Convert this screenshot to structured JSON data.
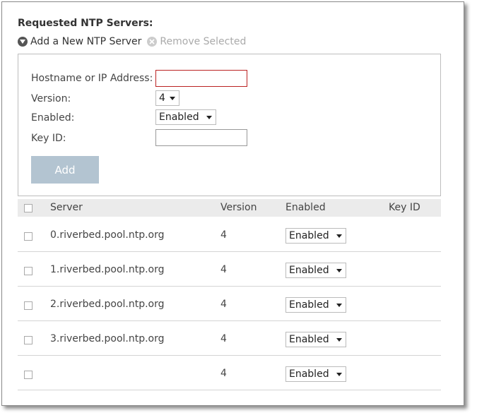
{
  "section_title": "Requested NTP Servers:",
  "actions": {
    "add_label": "Add a New NTP Server",
    "remove_label": "Remove Selected"
  },
  "form": {
    "hostname_label": "Hostname or IP Address:",
    "hostname_value": "",
    "version_label": "Version:",
    "version_value": "4",
    "enabled_label": "Enabled:",
    "enabled_value": "Enabled",
    "keyid_label": "Key ID:",
    "keyid_value": "",
    "add_button": "Add"
  },
  "table": {
    "columns": [
      "Server",
      "Version",
      "Enabled",
      "Key ID"
    ],
    "rows": [
      {
        "server": "0.riverbed.pool.ntp.org",
        "version": "4",
        "enabled": "Enabled",
        "key_id": ""
      },
      {
        "server": "1.riverbed.pool.ntp.org",
        "version": "4",
        "enabled": "Enabled",
        "key_id": ""
      },
      {
        "server": "2.riverbed.pool.ntp.org",
        "version": "4",
        "enabled": "Enabled",
        "key_id": ""
      },
      {
        "server": "3.riverbed.pool.ntp.org",
        "version": "4",
        "enabled": "Enabled",
        "key_id": ""
      },
      {
        "server": "",
        "version": "4",
        "enabled": "Enabled",
        "key_id": ""
      }
    ]
  },
  "colors": {
    "add_button_bg": "#b3c4d1",
    "error_border": "#bb2222",
    "header_bg": "#ebebeb"
  }
}
